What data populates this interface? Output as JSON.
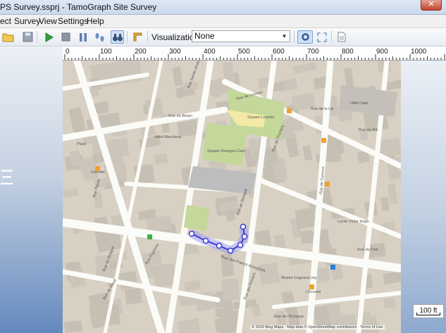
{
  "window": {
    "title": "PS Survey.ssprj - TamoGraph Site Survey",
    "close_label": "✕"
  },
  "menu": [
    {
      "label": "ect"
    },
    {
      "label": "Survey"
    },
    {
      "label": "View"
    },
    {
      "label": "Settings"
    },
    {
      "label": "Help"
    }
  ],
  "toolbar": {
    "visualization_label": "Visualization:",
    "visualization_value": "None"
  },
  "ruler": {
    "labels": [
      "0",
      "100",
      "200",
      "300",
      "400",
      "500",
      "600",
      "700",
      "800",
      "900",
      "1000"
    ]
  },
  "left_panel_glyph": "Ξ",
  "map": {
    "labels": [
      "Square Louvois",
      "Rue de Louvois",
      "Square Georges-Cain",
      "Rue de la Loi",
      "Rue Pavée",
      "Rue de Sévigné",
      "Rue de Turenne",
      "Rue du Roi",
      "Rue de Birague",
      "Rue des Francs Bourgeois",
      "Rue du Foin",
      "Rue de Rivoli",
      "Rue Payenne",
      "Rue des Rosiers",
      "Rue de l'Écharpe",
      "L'Écurial",
      "Carrelet",
      "Place",
      "Rue de Béarn",
      "Rue Sainte-Anastase",
      "Rue de Thorigny",
      "Hôtel Marcheux",
      "Hôtel Salé",
      "Musée Cognacq-Jay",
      "Lycée Victor Hugo"
    ],
    "attribution": "© 2016 Bing Maps · Map data © OpenStreetMap contributors · Terms of Use"
  },
  "scale": {
    "label": "100 ft"
  }
}
